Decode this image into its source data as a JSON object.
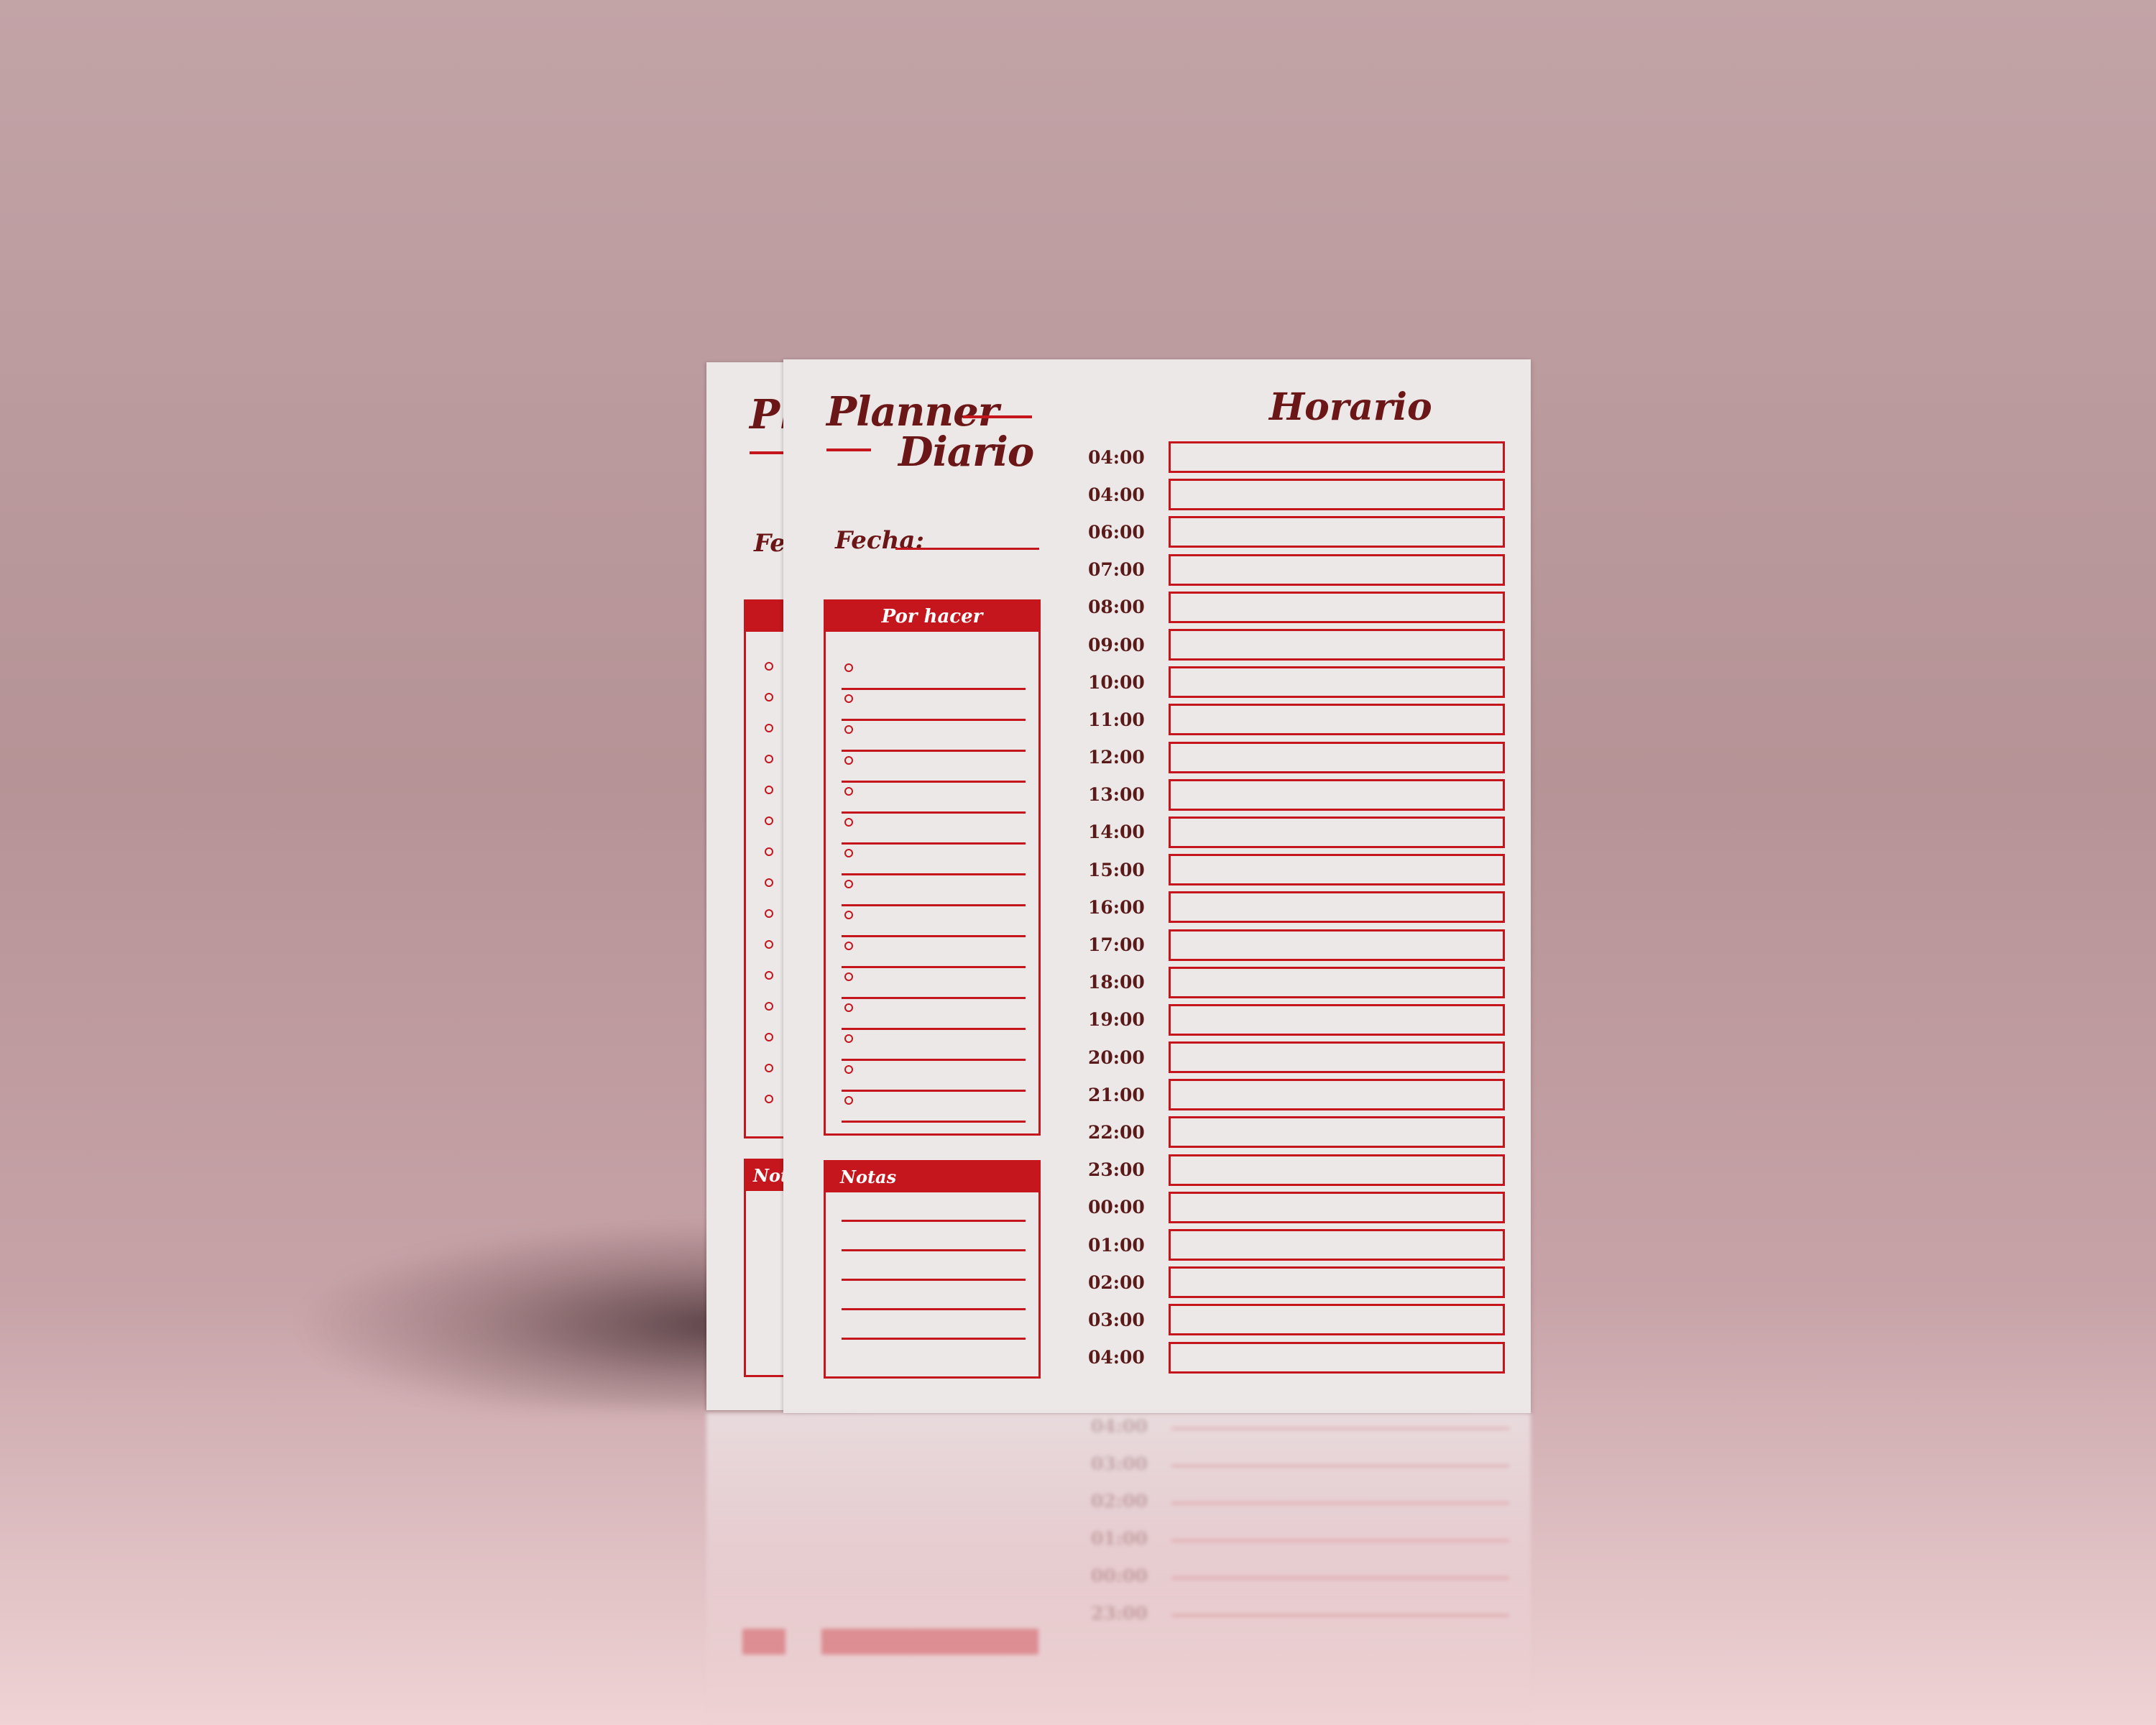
{
  "planner": {
    "title_line1": "Planner",
    "title_line2": "Diario",
    "fecha_label": "Fecha:",
    "todo_title": "Por hacer",
    "todo_items": 15,
    "notes_title": "Notas",
    "notes_lines": 5,
    "schedule_title": "Horario",
    "times": [
      "04:00",
      "04:00",
      "06:00",
      "07:00",
      "08:00",
      "09:00",
      "10:00",
      "11:00",
      "12:00",
      "13:00",
      "14:00",
      "15:00",
      "16:00",
      "17:00",
      "18:00",
      "19:00",
      "20:00",
      "21:00",
      "22:00",
      "23:00",
      "00:00",
      "01:00",
      "02:00",
      "03:00",
      "04:00"
    ]
  },
  "back_sheet": {
    "title_fragment": "Pla",
    "fecha_fragment": "Fech",
    "notes_fragment": "Notas"
  },
  "colors": {
    "accent": "#c4161c",
    "ink": "#6b1717",
    "paper": "#ece8e7",
    "background": "#b99a9d"
  }
}
